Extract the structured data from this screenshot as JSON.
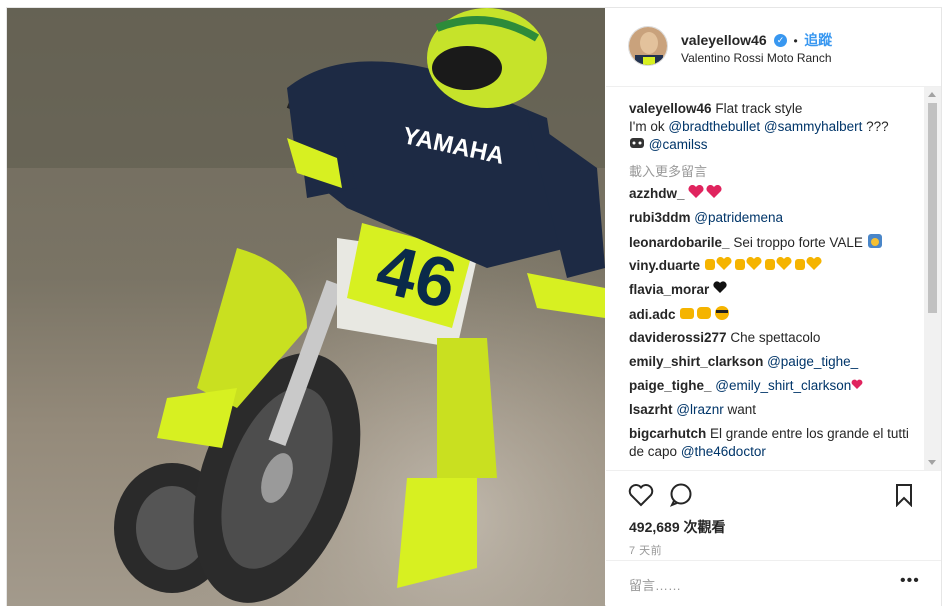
{
  "header": {
    "username": "valeyellow46",
    "dot": "•",
    "follow_label": "追蹤",
    "location": "Valentino Rossi Moto Ranch"
  },
  "caption": {
    "username": "valeyellow46",
    "text1": "Flat track style",
    "text2": "I'm ok",
    "mention1": "@bradthebullet",
    "mention2": "@sammyhalbert",
    "suffix": "???",
    "mention3": "@camilss"
  },
  "load_more": "載入更多留言",
  "comments": [
    {
      "user": "azzhdw_",
      "text": "",
      "mention": ""
    },
    {
      "user": "rubi3ddm",
      "text": "",
      "mention": "@patridemena"
    },
    {
      "user": "leonardobarile_",
      "text": "Sei troppo forte VALE",
      "mention": ""
    },
    {
      "user": "viny.duarte",
      "text": "",
      "mention": ""
    },
    {
      "user": "flavia_morar",
      "text": "",
      "mention": ""
    },
    {
      "user": "adi.adc",
      "text": "",
      "mention": ""
    },
    {
      "user": "daviderossi277",
      "text": "Che spettacolo",
      "mention": ""
    },
    {
      "user": "emily_shirt_clarkson",
      "text": "",
      "mention": "@paige_tighe_"
    },
    {
      "user": "paige_tighe_",
      "text": "",
      "mention": "@emily_shirt_clarkson"
    },
    {
      "user": "lsazrht",
      "text": "want",
      "mention": "@lraznr"
    },
    {
      "user": "bigcarhutch",
      "text": "El grande entre los grande el tutti de capo",
      "mention": "@the46doctor"
    }
  ],
  "views": "492,689 次觀看",
  "time_ago": "7 天前",
  "comment_placeholder": "留言……",
  "more_label": "•••",
  "colors": {
    "accent": "#3897f0",
    "mention": "#003569",
    "muted": "#999999"
  },
  "icons": [
    "heart-icon",
    "comment-icon",
    "bookmark-icon",
    "verified-icon",
    "more-icon"
  ]
}
